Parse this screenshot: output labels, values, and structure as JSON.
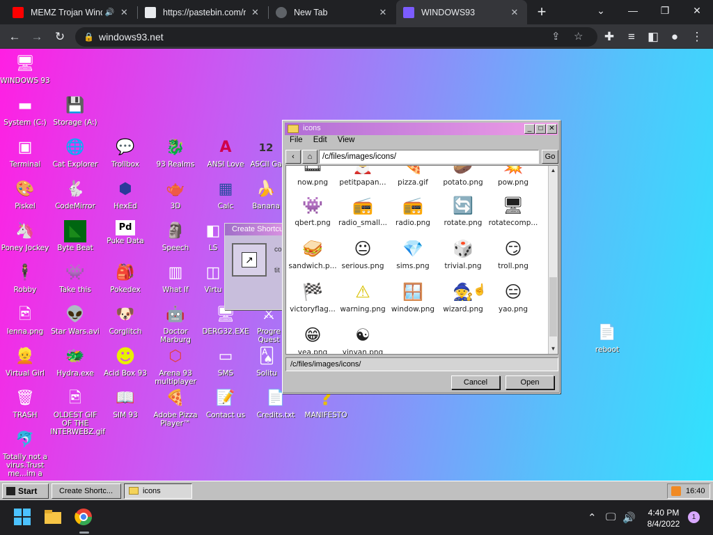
{
  "browser": {
    "tabs": [
      {
        "title": "MEMZ Trojan Wind",
        "fav_color": "#ff0000"
      },
      {
        "title": "https://pastebin.com/ra",
        "fav_color": "#e8eaed"
      },
      {
        "title": "New Tab",
        "fav_color": "#5f6368"
      },
      {
        "title": "WINDOWS93",
        "fav_color": "#7c5cff"
      }
    ],
    "url": "windows93.net"
  },
  "desktop_icons": [
    {
      "label": "WINDOWS 93",
      "glyph": "🖥"
    },
    {
      "label": "System (C:)",
      "glyph": "▬"
    },
    {
      "label": "Storage (A:)",
      "glyph": "💾"
    },
    {
      "label": "Terminal",
      "glyph": "▣"
    },
    {
      "label": "Cat Explorer",
      "glyph": "🌐"
    },
    {
      "label": "Trollbox",
      "glyph": "💬"
    },
    {
      "label": "93 Realms",
      "glyph": "🐉"
    },
    {
      "label": "ANSI Love",
      "glyph": "A"
    },
    {
      "label": "ASCII Ga",
      "glyph": "12"
    },
    {
      "label": "Piskel",
      "glyph": "🎨"
    },
    {
      "label": "CodeMirror",
      "glyph": "🐇"
    },
    {
      "label": "HexEd",
      "glyph": "⬢"
    },
    {
      "label": "3D",
      "glyph": "🫖"
    },
    {
      "label": "Calc",
      "glyph": "▦"
    },
    {
      "label": "Banana",
      "glyph": "🍌"
    },
    {
      "label": "Poney Jockey",
      "glyph": "🦄"
    },
    {
      "label": "Byte Beat",
      "glyph": "◣"
    },
    {
      "label": "Puke Data",
      "glyph": "Pd"
    },
    {
      "label": "Speech",
      "glyph": "🗿"
    },
    {
      "label": "LS",
      "glyph": "◧"
    },
    {
      "label": "Robby",
      "glyph": "🕴"
    },
    {
      "label": "Take this",
      "glyph": "👾"
    },
    {
      "label": "Pokedex",
      "glyph": "🎒"
    },
    {
      "label": "What If",
      "glyph": "▥"
    },
    {
      "label": "Virtu",
      "glyph": "◫"
    },
    {
      "label": "lenna.png",
      "glyph": "🖻"
    },
    {
      "label": "Star Wars.avi",
      "glyph": "👽"
    },
    {
      "label": "Corglitch",
      "glyph": "🐶"
    },
    {
      "label": "Doctor Marburg",
      "glyph": "🤖"
    },
    {
      "label": "DERG32.EXE",
      "glyph": "🖥"
    },
    {
      "label": "Progre Quest",
      "glyph": "⚔"
    },
    {
      "label": "Virtual Girl",
      "glyph": "👱"
    },
    {
      "label": "Hydra.exe",
      "glyph": "🐲"
    },
    {
      "label": "Acid Box 93",
      "glyph": "☻"
    },
    {
      "label": "Arena 93 multiplayer",
      "glyph": "⬡"
    },
    {
      "label": "SMS",
      "glyph": "▭"
    },
    {
      "label": "Solitu",
      "glyph": "🂡"
    },
    {
      "label": "TRASH",
      "glyph": "🗑"
    },
    {
      "label": "OLDEST GIF OF THE INTERWEBZ.gif",
      "glyph": "🖻"
    },
    {
      "label": "SIM 93",
      "glyph": "📖"
    },
    {
      "label": "Adobe Pizza Player™",
      "glyph": "🍕"
    },
    {
      "label": "Contact us",
      "glyph": "📝"
    },
    {
      "label": "Credits.txt",
      "glyph": "📄"
    },
    {
      "label": "MANIFESTO",
      "glyph": "?"
    },
    {
      "label": "Totally not a virus.Trust me...im a",
      "glyph": "🐬"
    },
    {
      "label": "reboot",
      "glyph": "📄"
    }
  ],
  "shortcut_dialog": {
    "title": "Create Shortcut",
    "label_1": "co",
    "label_2": "tit"
  },
  "file_window": {
    "title": "icons",
    "menu": [
      "File",
      "Edit",
      "View"
    ],
    "path": "/c/files/images/icons/",
    "go_label": "Go",
    "back_label": "‹",
    "files": [
      {
        "name": "now.png",
        "glyph": "🎞"
      },
      {
        "name": "petitpapan...",
        "glyph": "🎅"
      },
      {
        "name": "pizza.gif",
        "glyph": "🍕"
      },
      {
        "name": "potato.png",
        "glyph": "🥔"
      },
      {
        "name": "pow.png",
        "glyph": "💥"
      },
      {
        "name": "qbert.png",
        "glyph": "👾"
      },
      {
        "name": "radio_small...",
        "glyph": "📻"
      },
      {
        "name": "radio.png",
        "glyph": "📻"
      },
      {
        "name": "rotate.png",
        "glyph": "🔄"
      },
      {
        "name": "rotatecomp...",
        "glyph": "🖥"
      },
      {
        "name": "sandwich.p...",
        "glyph": "🥪"
      },
      {
        "name": "serious.png",
        "glyph": "😐"
      },
      {
        "name": "sims.png",
        "glyph": "💎"
      },
      {
        "name": "trivial.png",
        "glyph": "🎲"
      },
      {
        "name": "troll.png",
        "glyph": "😏"
      },
      {
        "name": "victoryflag...",
        "glyph": "🏁"
      },
      {
        "name": "warning.png",
        "glyph": "⚠"
      },
      {
        "name": "window.png",
        "glyph": "🪟"
      },
      {
        "name": "wizard.png",
        "glyph": "🧙"
      },
      {
        "name": "yao.png",
        "glyph": "😑"
      },
      {
        "name": "yea.png",
        "glyph": "😁"
      },
      {
        "name": "yinyan.png",
        "glyph": "☯"
      }
    ],
    "status": "/c/files/images/icons/",
    "cancel_label": "Cancel",
    "open_label": "Open"
  },
  "w93_taskbar": {
    "start_label": "Start",
    "items": [
      "Create Shortc...",
      "icons"
    ],
    "tray_time": "16:40"
  },
  "os_taskbar": {
    "time": "4:40 PM",
    "date": "8/4/2022",
    "notifications": "1"
  },
  "colors": {
    "chrome_bg": "#202124",
    "window_title_start": "#b16ed6",
    "window_title_end": "#ef9de6"
  }
}
